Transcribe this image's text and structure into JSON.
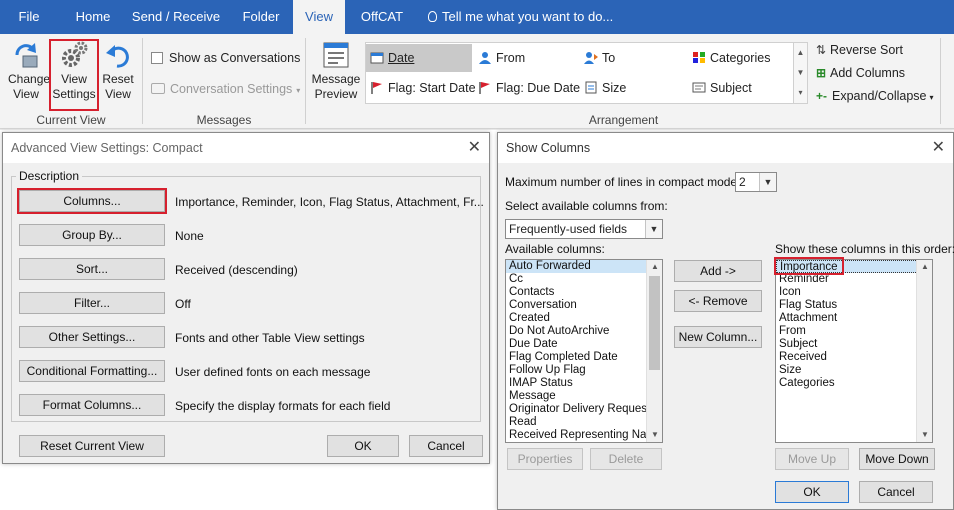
{
  "ribbon": {
    "tabs": [
      {
        "label": "File"
      },
      {
        "label": "Home"
      },
      {
        "label": "Send / Receive"
      },
      {
        "label": "Folder"
      },
      {
        "label": "View",
        "active": true
      },
      {
        "label": "OffCAT"
      }
    ],
    "tell_me": "Tell me what you want to do...",
    "current_view": {
      "change_view": "Change View",
      "view_settings": "View Settings",
      "reset_view": "Reset View",
      "group_label": "Current View"
    },
    "messages": {
      "show_as_conversations": "Show as Conversations",
      "conversation_settings": "Conversation Settings",
      "group_label": "Messages"
    },
    "arrangement": {
      "message_preview": "Message Preview",
      "items": [
        "Date",
        "From",
        "To",
        "Categories",
        "Flag: Start Date",
        "Flag: Due Date",
        "Size",
        "Subject"
      ],
      "selected": "Date",
      "reverse_sort": "Reverse Sort",
      "add_columns": "Add Columns",
      "expand_collapse": "Expand/Collapse",
      "group_label": "Arrangement"
    },
    "colors": {
      "tabbar": "#2b64b7",
      "highlight": "#d6202e"
    }
  },
  "advanced_view": {
    "title": "Advanced View Settings: Compact",
    "section": "Description",
    "rows": [
      {
        "button": "Columns...",
        "value": "Importance, Reminder, Icon, Flag Status, Attachment, Fr..."
      },
      {
        "button": "Group By...",
        "value": "None"
      },
      {
        "button": "Sort...",
        "value": "Received (descending)"
      },
      {
        "button": "Filter...",
        "value": "Off"
      },
      {
        "button": "Other Settings...",
        "value": "Fonts and other Table View settings"
      },
      {
        "button": "Conditional Formatting...",
        "value": "User defined fonts on each message"
      },
      {
        "button": "Format Columns...",
        "value": "Specify the display formats for each field"
      }
    ],
    "reset_button": "Reset Current View",
    "ok_button": "OK",
    "cancel_button": "Cancel"
  },
  "show_columns": {
    "title": "Show Columns",
    "max_lines_label": "Maximum number of lines in compact mode:",
    "max_lines_value": "2",
    "select_from_label": "Select available columns from:",
    "select_from_value": "Frequently-used fields",
    "available_label": "Available columns:",
    "available": [
      "Auto Forwarded",
      "Cc",
      "Contacts",
      "Conversation",
      "Created",
      "Do Not AutoArchive",
      "Due Date",
      "Flag Completed Date",
      "Follow Up Flag",
      "IMAP Status",
      "Message",
      "Originator Delivery Reques",
      "Read",
      "Received Representing Nar"
    ],
    "shown_label": "Show these columns in this order:",
    "shown": [
      "Importance",
      "Reminder",
      "Icon",
      "Flag Status",
      "Attachment",
      "From",
      "Subject",
      "Received",
      "Size",
      "Categories"
    ],
    "add_button": "Add ->",
    "remove_button": "<- Remove",
    "new_column_button": "New Column...",
    "properties_button": "Properties",
    "delete_button": "Delete",
    "move_up_button": "Move Up",
    "move_down_button": "Move Down",
    "ok_button": "OK",
    "cancel_button": "Cancel"
  }
}
